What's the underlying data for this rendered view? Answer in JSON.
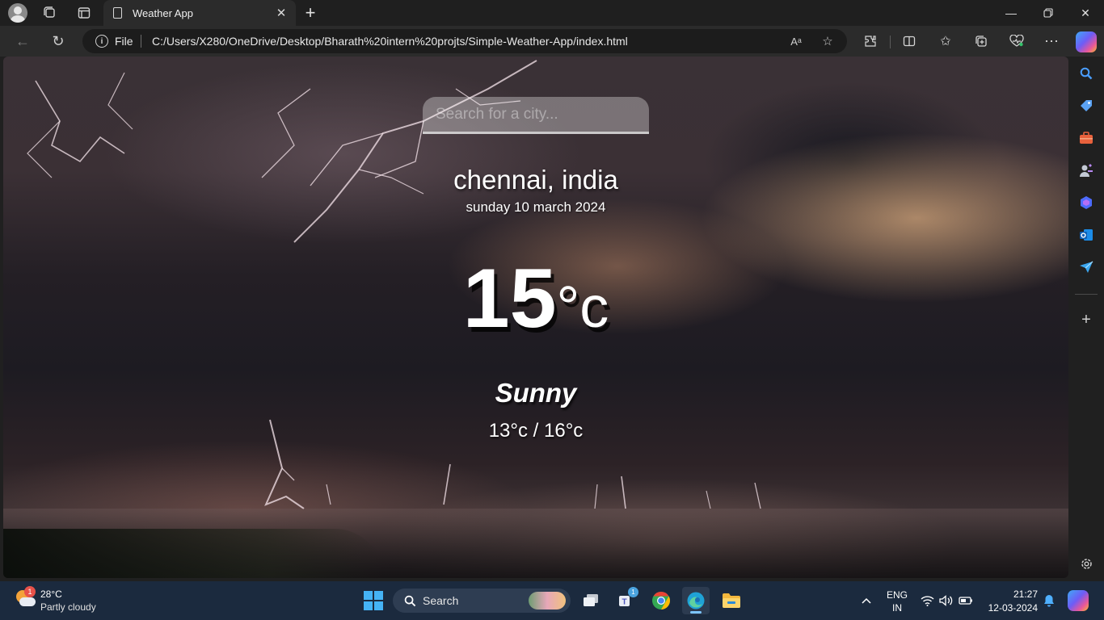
{
  "browser": {
    "tab_title": "Weather App",
    "address_scheme": "File",
    "url": "C:/Users/X280/OneDrive/Desktop/Bharath%20intern%20projts/Simple-Weather-App/index.html",
    "read_aloud_label": "Aᵃ"
  },
  "weather_app": {
    "search_placeholder": "Search for a city...",
    "city": "chennai, india",
    "date": "sunday 10 march 2024",
    "temperature": "15",
    "temperature_unit": "°c",
    "condition": "Sunny",
    "range": "13°c / 16°c"
  },
  "taskbar": {
    "weather_badge": "1",
    "weather_temp": "28°C",
    "weather_desc": "Partly cloudy",
    "search_label": "Search",
    "teams_badge": "1",
    "lang_top": "ENG",
    "lang_bottom": "IN",
    "time": "21:27",
    "date": "12-03-2024"
  },
  "colors": {
    "sidebar_search": "#4a9eff",
    "sidebar_shopping": "#5ba3f5",
    "sidebar_tools": "#e8613c",
    "sidebar_games": "#b98af5",
    "sidebar_m365": "#4d6bfe",
    "sidebar_outlook": "#1b8ce8",
    "sidebar_drop": "#3aa6f0",
    "start_accent": "#45b3f5"
  }
}
